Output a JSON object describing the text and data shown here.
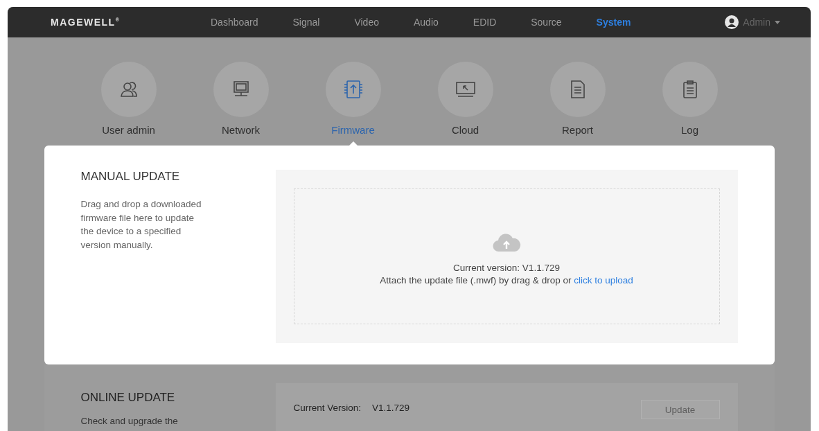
{
  "nav": {
    "logo": "MAGEWELL$^{®}$",
    "tabs": [
      {
        "label": "Dashboard",
        "selected": false
      },
      {
        "label": "Signal",
        "selected": false
      },
      {
        "label": "Video",
        "selected": false
      },
      {
        "label": "Audio",
        "selected": false
      },
      {
        "label": "EDID",
        "selected": false
      },
      {
        "label": "Source",
        "selected": false
      },
      {
        "label": "System",
        "selected": true
      }
    ],
    "user": "Admin"
  },
  "categories": [
    {
      "kind": "user",
      "label": "User admin",
      "selected": false
    },
    {
      "kind": "network",
      "label": "Network",
      "selected": false
    },
    {
      "kind": "firmware",
      "label": "Firmware",
      "selected": true
    },
    {
      "kind": "cloud",
      "label": "Cloud",
      "selected": false
    },
    {
      "kind": "report",
      "label": "Report",
      "selected": false
    },
    {
      "kind": "log",
      "label": "Log",
      "selected": false
    }
  ],
  "manual_update": {
    "title": "MANUAL UPDATE",
    "description": "Drag and drop a downloaded firmware file here to update the device to a specified version manually.",
    "current_version": "Current version: V1.1.729",
    "instruction": "Attach the update file (.mwf) by drag & drop or",
    "link": "click to upload"
  },
  "online_update": {
    "title": "ONLINE UPDATE",
    "description": "Check and upgrade the",
    "current_version_label": "Current Version:",
    "current_version": "V1.1.729",
    "button": {
      "label": "Update",
      "disabled": true
    }
  }
}
